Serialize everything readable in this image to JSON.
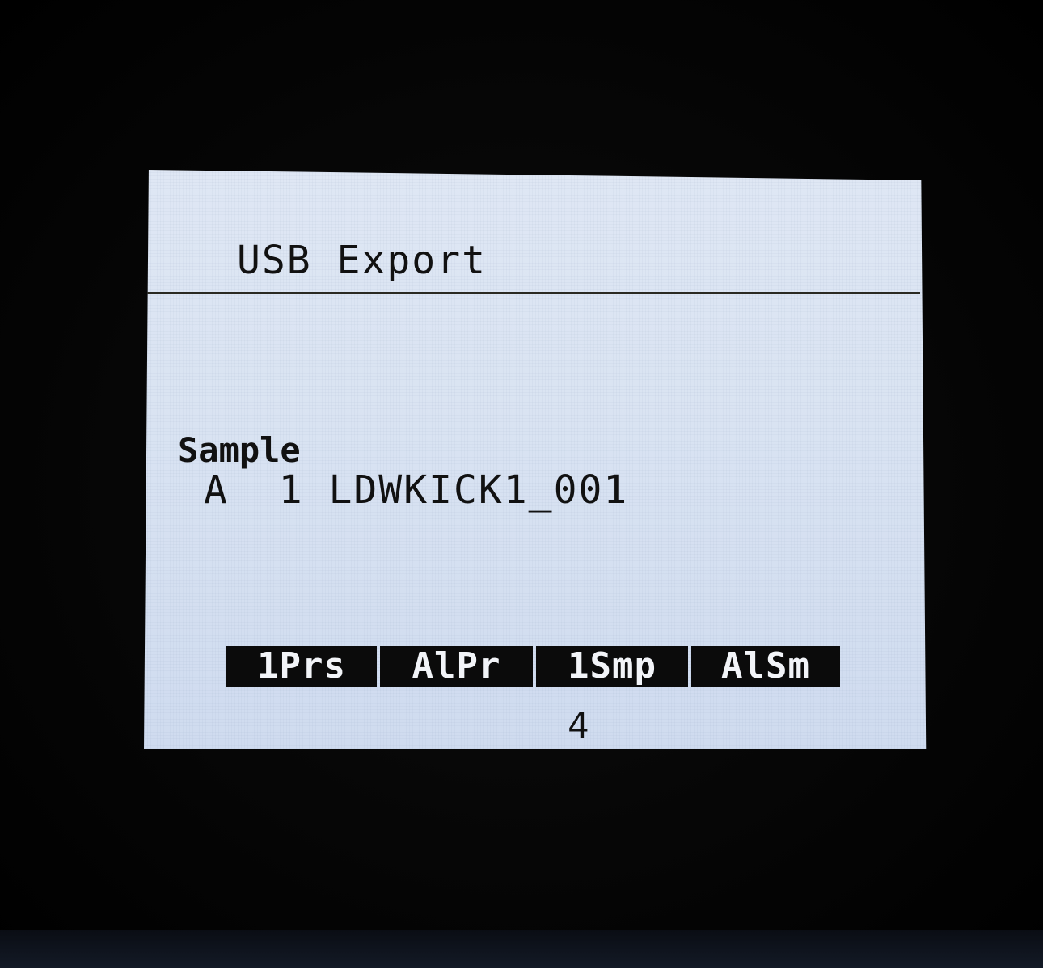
{
  "screen": {
    "title": "USB Export"
  },
  "parameter": {
    "label": "Sample",
    "value": "A  1 LDWKICK1_001"
  },
  "softkeys": [
    {
      "label": "1Prs"
    },
    {
      "label": "AlPr"
    },
    {
      "label": "1Smp"
    },
    {
      "label": "AlSm"
    }
  ],
  "page": {
    "number": "4"
  },
  "colors": {
    "lcd_background": "#d9e3f2",
    "text": "#111111",
    "softkey_background": "#0b0b0b",
    "softkey_text": "#f2f4f8",
    "bezel": "#050505"
  }
}
